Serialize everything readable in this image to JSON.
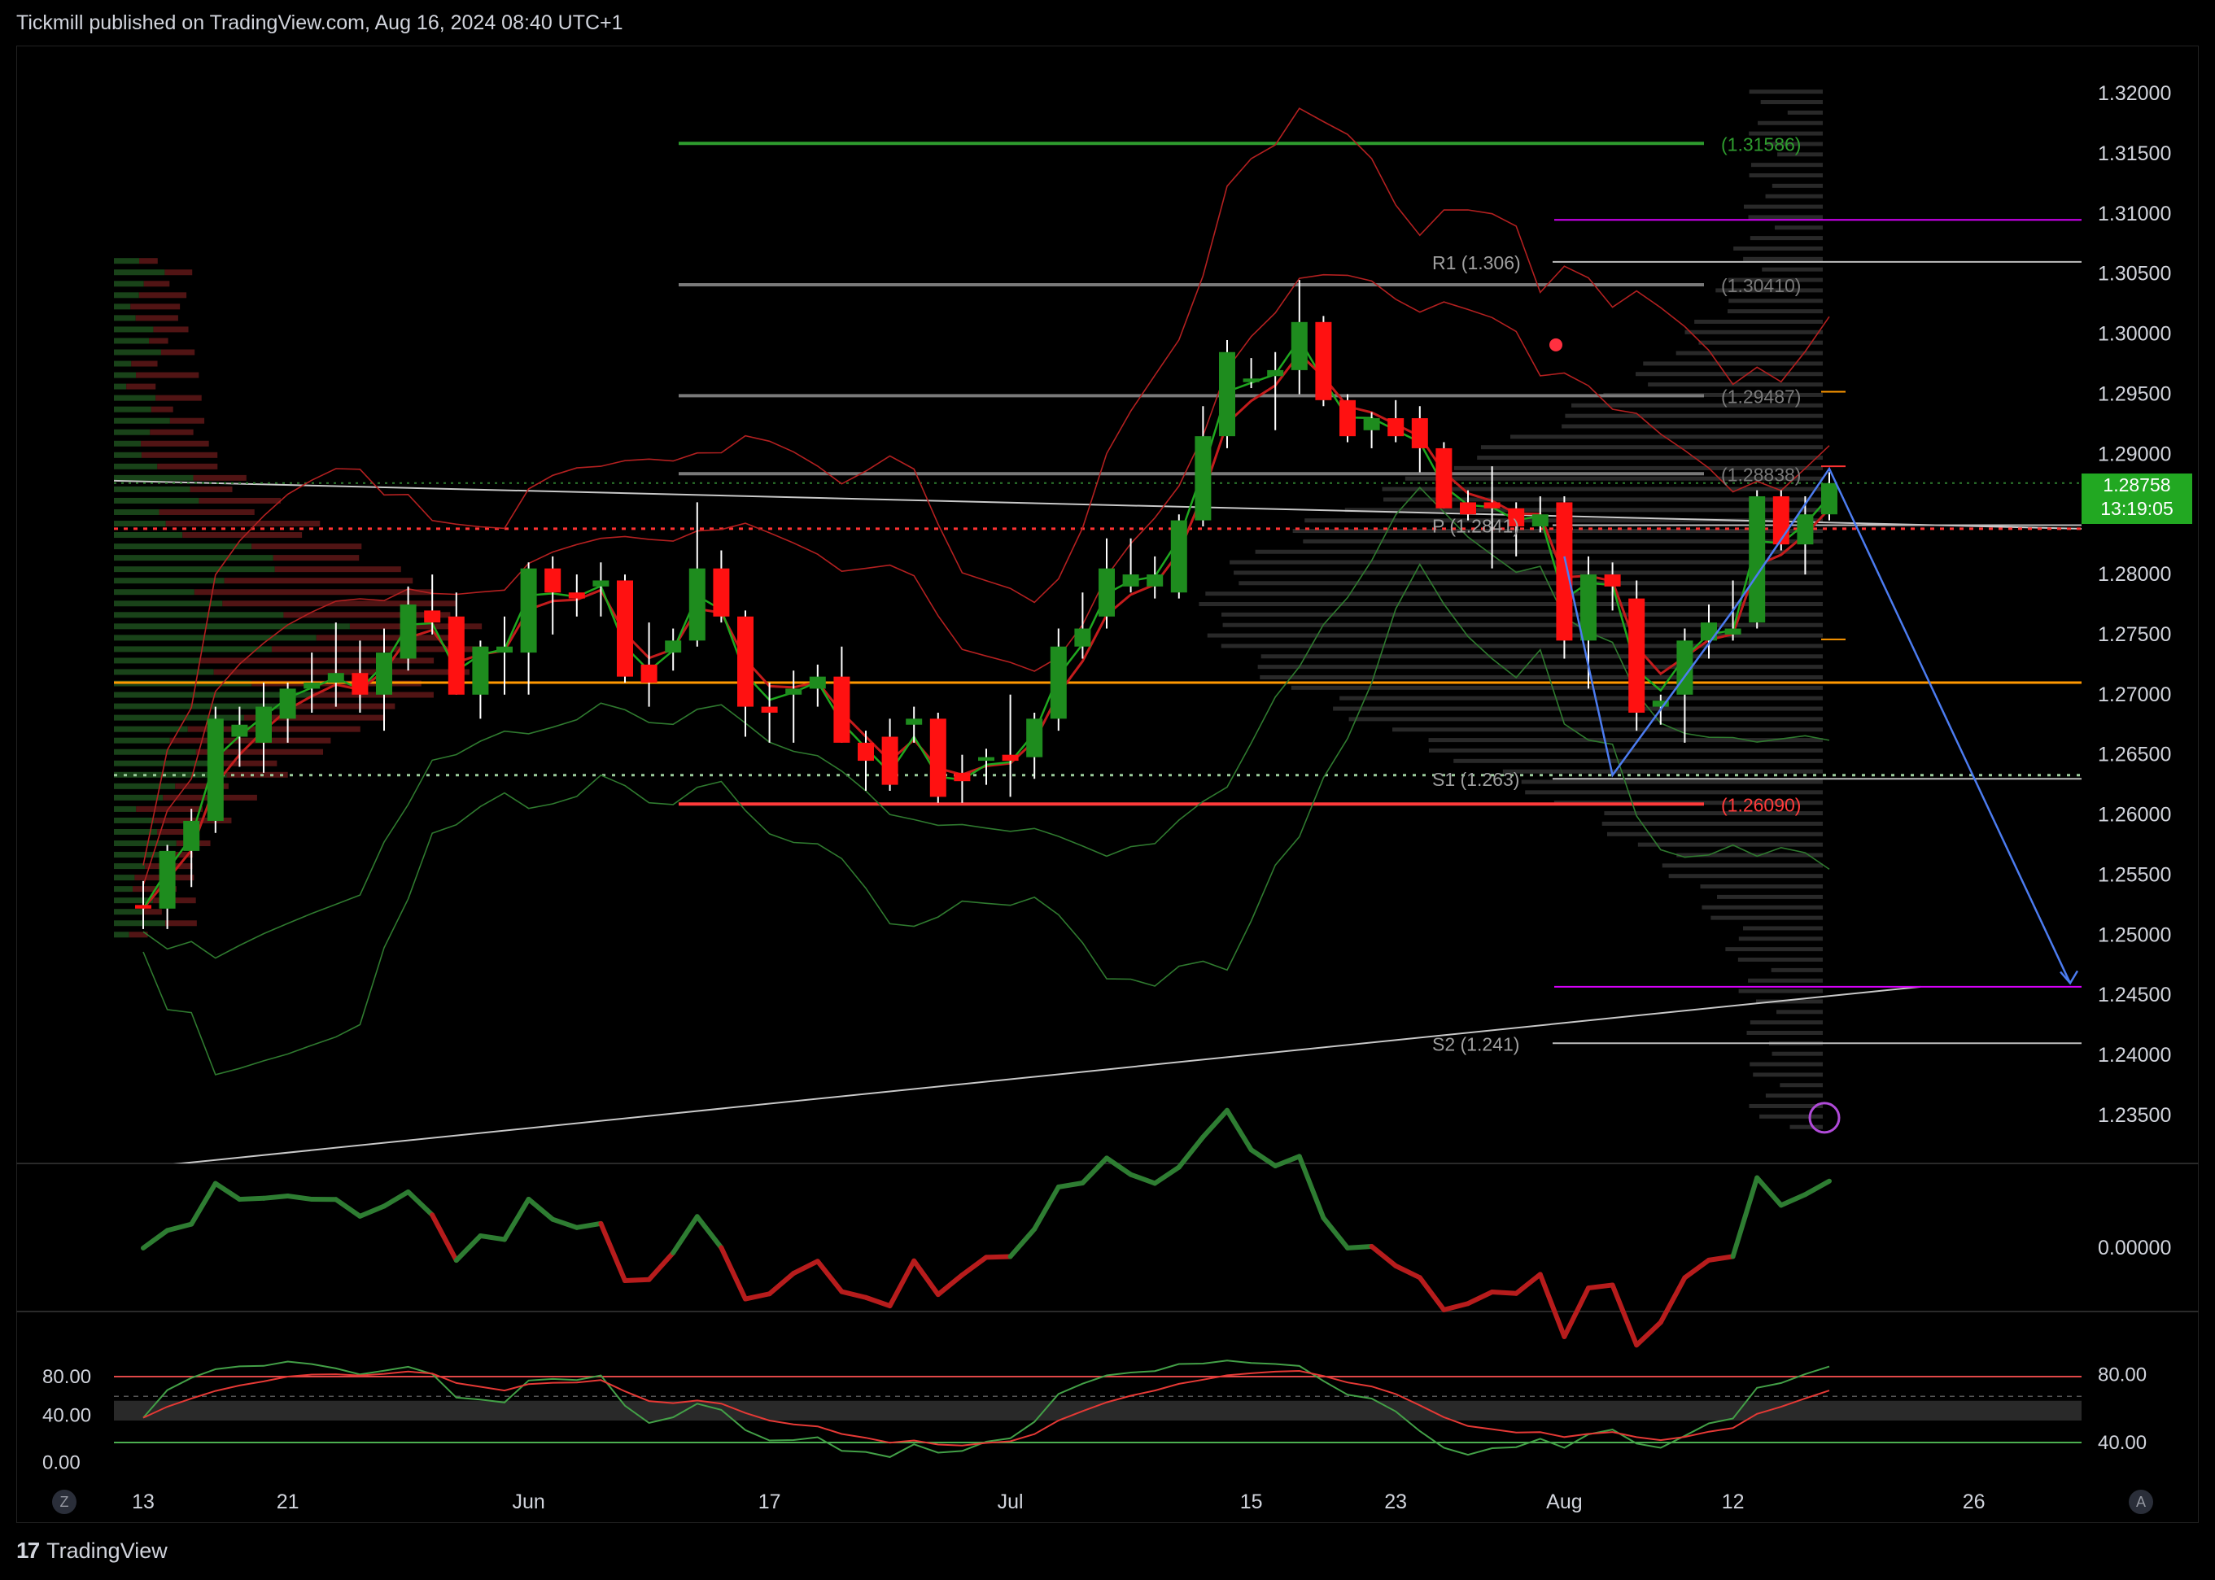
{
  "header": {
    "published": "Tickmill published on TradingView.com, Aug 16, 2024 08:40 UTC+1"
  },
  "footer": {
    "brand": "TradingView",
    "btn_left": "Z",
    "btn_right": "A"
  },
  "colors": {
    "up": "#1e8c1e",
    "down": "#ff1111",
    "orange": "#ff9800",
    "purple": "#d500f9",
    "blue": "#4c7cf0",
    "grey": "#8a8a8a"
  },
  "price_badge": {
    "price": "1.28758",
    "countdown": "13:19:05"
  },
  "chart_data": {
    "type": "candlestick",
    "price_axis": {
      "ylim": [
        1.231,
        1.324
      ],
      "ticks": [
        "1.32000",
        "1.31500",
        "1.31000",
        "1.30500",
        "1.30000",
        "1.29500",
        "1.29000",
        "1.28500",
        "1.28000",
        "1.27500",
        "1.27000",
        "1.26500",
        "1.26000",
        "1.25500",
        "1.25000",
        "1.24500",
        "1.24000",
        "1.23500"
      ]
    },
    "time_axis": {
      "labels": [
        {
          "label": "13",
          "i": 0
        },
        {
          "label": "21",
          "i": 6
        },
        {
          "label": "Jun",
          "i": 16
        },
        {
          "label": "17",
          "i": 26
        },
        {
          "label": "Jul",
          "i": 36
        },
        {
          "label": "15",
          "i": 46
        },
        {
          "label": "23",
          "i": 52
        },
        {
          "label": "Aug",
          "i": 59
        },
        {
          "label": "12",
          "i": 66
        },
        {
          "label": "26",
          "i": 76
        }
      ]
    },
    "candles": [
      {
        "o": 1.2525,
        "h": 1.2545,
        "l": 1.2505,
        "c": 1.2522
      },
      {
        "o": 1.2522,
        "h": 1.2575,
        "l": 1.2505,
        "c": 1.257
      },
      {
        "o": 1.257,
        "h": 1.2605,
        "l": 1.254,
        "c": 1.2595
      },
      {
        "o": 1.2595,
        "h": 1.269,
        "l": 1.2585,
        "c": 1.268
      },
      {
        "o": 1.2665,
        "h": 1.269,
        "l": 1.264,
        "c": 1.2675
      },
      {
        "o": 1.266,
        "h": 1.271,
        "l": 1.2635,
        "c": 1.269
      },
      {
        "o": 1.268,
        "h": 1.271,
        "l": 1.266,
        "c": 1.2705
      },
      {
        "o": 1.2705,
        "h": 1.2735,
        "l": 1.2685,
        "c": 1.271
      },
      {
        "o": 1.271,
        "h": 1.276,
        "l": 1.269,
        "c": 1.2718
      },
      {
        "o": 1.2718,
        "h": 1.2745,
        "l": 1.2685,
        "c": 1.27
      },
      {
        "o": 1.27,
        "h": 1.2755,
        "l": 1.267,
        "c": 1.2735
      },
      {
        "o": 1.273,
        "h": 1.279,
        "l": 1.272,
        "c": 1.2775
      },
      {
        "o": 1.277,
        "h": 1.28,
        "l": 1.275,
        "c": 1.276
      },
      {
        "o": 1.2765,
        "h": 1.2785,
        "l": 1.27,
        "c": 1.27
      },
      {
        "o": 1.27,
        "h": 1.2745,
        "l": 1.268,
        "c": 1.274
      },
      {
        "o": 1.2735,
        "h": 1.2765,
        "l": 1.27,
        "c": 1.274
      },
      {
        "o": 1.2735,
        "h": 1.281,
        "l": 1.27,
        "c": 1.2805
      },
      {
        "o": 1.2805,
        "h": 1.2815,
        "l": 1.275,
        "c": 1.2785
      },
      {
        "o": 1.2785,
        "h": 1.28,
        "l": 1.2765,
        "c": 1.278
      },
      {
        "o": 1.279,
        "h": 1.281,
        "l": 1.2765,
        "c": 1.2795
      },
      {
        "o": 1.2795,
        "h": 1.28,
        "l": 1.271,
        "c": 1.2715
      },
      {
        "o": 1.2725,
        "h": 1.276,
        "l": 1.269,
        "c": 1.271
      },
      {
        "o": 1.2735,
        "h": 1.2755,
        "l": 1.272,
        "c": 1.2745
      },
      {
        "o": 1.2745,
        "h": 1.286,
        "l": 1.274,
        "c": 1.2805
      },
      {
        "o": 1.2805,
        "h": 1.282,
        "l": 1.276,
        "c": 1.2765
      },
      {
        "o": 1.2765,
        "h": 1.277,
        "l": 1.2665,
        "c": 1.269
      },
      {
        "o": 1.269,
        "h": 1.271,
        "l": 1.266,
        "c": 1.2685
      },
      {
        "o": 1.27,
        "h": 1.272,
        "l": 1.266,
        "c": 1.2705
      },
      {
        "o": 1.2705,
        "h": 1.2725,
        "l": 1.269,
        "c": 1.2715
      },
      {
        "o": 1.2715,
        "h": 1.274,
        "l": 1.266,
        "c": 1.266
      },
      {
        "o": 1.266,
        "h": 1.267,
        "l": 1.262,
        "c": 1.2645
      },
      {
        "o": 1.2665,
        "h": 1.268,
        "l": 1.262,
        "c": 1.2625
      },
      {
        "o": 1.2675,
        "h": 1.269,
        "l": 1.266,
        "c": 1.268
      },
      {
        "o": 1.268,
        "h": 1.2685,
        "l": 1.261,
        "c": 1.2615
      },
      {
        "o": 1.2635,
        "h": 1.265,
        "l": 1.261,
        "c": 1.2628
      },
      {
        "o": 1.2645,
        "h": 1.2655,
        "l": 1.2625,
        "c": 1.2648
      },
      {
        "o": 1.265,
        "h": 1.27,
        "l": 1.2615,
        "c": 1.2645
      },
      {
        "o": 1.2648,
        "h": 1.2685,
        "l": 1.263,
        "c": 1.268
      },
      {
        "o": 1.268,
        "h": 1.2755,
        "l": 1.267,
        "c": 1.274
      },
      {
        "o": 1.274,
        "h": 1.2785,
        "l": 1.273,
        "c": 1.2755
      },
      {
        "o": 1.2765,
        "h": 1.283,
        "l": 1.2755,
        "c": 1.2805
      },
      {
        "o": 1.279,
        "h": 1.283,
        "l": 1.2785,
        "c": 1.28
      },
      {
        "o": 1.279,
        "h": 1.2815,
        "l": 1.278,
        "c": 1.28
      },
      {
        "o": 1.2785,
        "h": 1.285,
        "l": 1.278,
        "c": 1.2845
      },
      {
        "o": 1.2845,
        "h": 1.294,
        "l": 1.284,
        "c": 1.2915
      },
      {
        "o": 1.2915,
        "h": 1.2995,
        "l": 1.2905,
        "c": 1.2985
      },
      {
        "o": 1.296,
        "h": 1.298,
        "l": 1.2955,
        "c": 1.2963
      },
      {
        "o": 1.2965,
        "h": 1.2985,
        "l": 1.292,
        "c": 1.297
      },
      {
        "o": 1.297,
        "h": 1.3045,
        "l": 1.295,
        "c": 1.301
      },
      {
        "o": 1.301,
        "h": 1.3015,
        "l": 1.294,
        "c": 1.2945
      },
      {
        "o": 1.2945,
        "h": 1.295,
        "l": 1.291,
        "c": 1.2915
      },
      {
        "o": 1.292,
        "h": 1.2935,
        "l": 1.2905,
        "c": 1.293
      },
      {
        "o": 1.293,
        "h": 1.2945,
        "l": 1.291,
        "c": 1.2915
      },
      {
        "o": 1.293,
        "h": 1.294,
        "l": 1.2885,
        "c": 1.2905
      },
      {
        "o": 1.2905,
        "h": 1.291,
        "l": 1.2855,
        "c": 1.2855
      },
      {
        "o": 1.286,
        "h": 1.287,
        "l": 1.2845,
        "c": 1.285
      },
      {
        "o": 1.286,
        "h": 1.289,
        "l": 1.2805,
        "c": 1.2855
      },
      {
        "o": 1.2855,
        "h": 1.286,
        "l": 1.2815,
        "c": 1.284
      },
      {
        "o": 1.284,
        "h": 1.2865,
        "l": 1.2835,
        "c": 1.285
      },
      {
        "o": 1.286,
        "h": 1.2865,
        "l": 1.273,
        "c": 1.2745
      },
      {
        "o": 1.2745,
        "h": 1.2815,
        "l": 1.2705,
        "c": 1.28
      },
      {
        "o": 1.28,
        "h": 1.281,
        "l": 1.277,
        "c": 1.279
      },
      {
        "o": 1.278,
        "h": 1.2795,
        "l": 1.267,
        "c": 1.2685
      },
      {
        "o": 1.269,
        "h": 1.27,
        "l": 1.2675,
        "c": 1.2695
      },
      {
        "o": 1.27,
        "h": 1.2755,
        "l": 1.266,
        "c": 1.2745
      },
      {
        "o": 1.2745,
        "h": 1.2775,
        "l": 1.273,
        "c": 1.276
      },
      {
        "o": 1.275,
        "h": 1.2795,
        "l": 1.2745,
        "c": 1.2755
      },
      {
        "o": 1.276,
        "h": 1.287,
        "l": 1.2755,
        "c": 1.2865
      },
      {
        "o": 1.2865,
        "h": 1.287,
        "l": 1.282,
        "c": 1.2825
      },
      {
        "o": 1.2825,
        "h": 1.2865,
        "l": 1.28,
        "c": 1.285
      },
      {
        "o": 1.285,
        "h": 1.2885,
        "l": 1.2845,
        "c": 1.2876
      }
    ],
    "horizontal_levels": [
      {
        "price": 1.31586,
        "label": "(1.31586)",
        "color": "#2e9c2e"
      },
      {
        "price": 1.3041,
        "label": "(1.30410)",
        "color": "#7a7a7a"
      },
      {
        "price": 1.29487,
        "label": "(1.29487)",
        "color": "#7a7a7a"
      },
      {
        "price": 1.28838,
        "label": "(1.28838)",
        "color": "#7a7a7a"
      },
      {
        "price": 1.2609,
        "label": "(1.26090)",
        "color": "#ff3b3b"
      }
    ],
    "pivots": [
      {
        "price": 1.306,
        "label": "R1 (1.306)"
      },
      {
        "price": 1.2841,
        "label": "P (1.2841)"
      },
      {
        "price": 1.263,
        "label": "S1 (1.263)"
      },
      {
        "price": 1.241,
        "label": "S2 (1.241)"
      }
    ],
    "orange_level": 1.271,
    "purple_levels": [
      1.3095,
      1.2457
    ],
    "oscillator": {
      "zero_label": "0.00000"
    },
    "stochastic": {
      "left_ticks": [
        "80.00",
        "40.00",
        "0.00"
      ],
      "right_ticks": [
        "80.00",
        "40.00"
      ]
    }
  }
}
